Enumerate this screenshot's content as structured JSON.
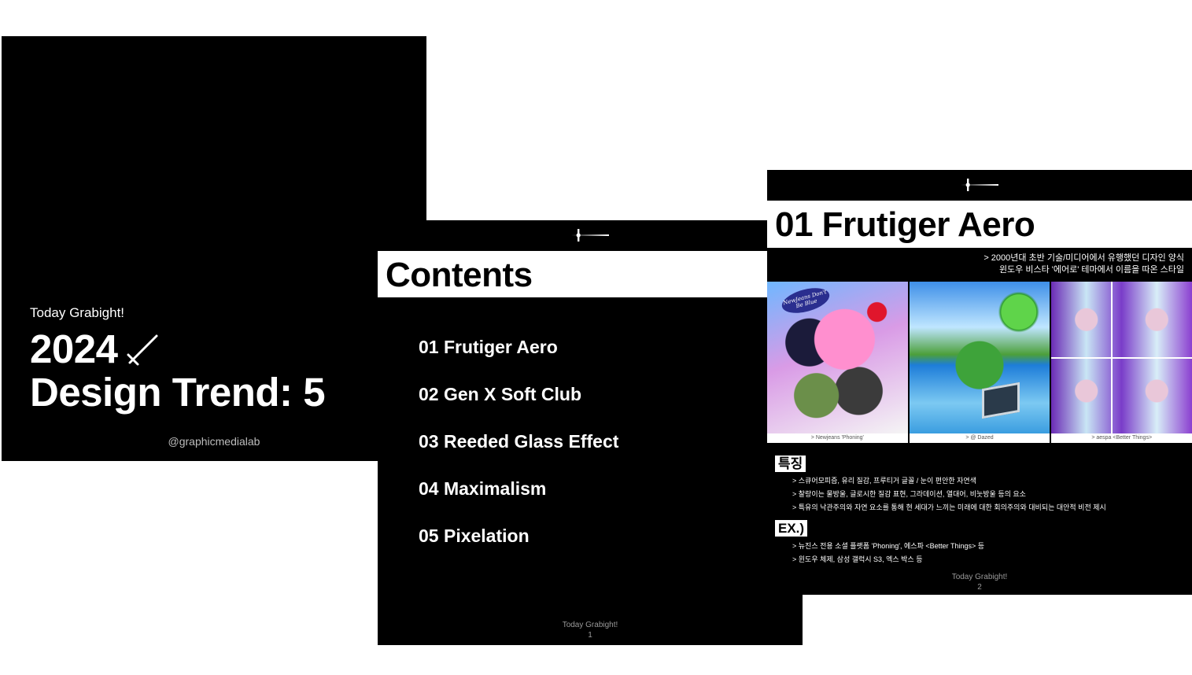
{
  "cover": {
    "subtitle": "Today Grabight!",
    "title_year": "2024",
    "title_line2": "Design Trend: 5",
    "handle": "@graphicmedialab",
    "icon": "sword-icon"
  },
  "contents": {
    "logo": "dagger-logo-icon",
    "title": "Contents",
    "items": [
      {
        "label": "01 Frutiger Aero"
      },
      {
        "label": "02 Gen X Soft Club"
      },
      {
        "label": "03 Reeded Glass Effect"
      },
      {
        "label": "04 Maximalism"
      },
      {
        "label": "05 Pixelation"
      }
    ],
    "footer_text": "Today Grabight!",
    "page_number": "1"
  },
  "aero": {
    "logo": "dagger-logo-icon",
    "title": "01 Frutiger Aero",
    "desc_line1": "> 2000년대 초반 기술/미디어에서 유행했던 디자인 양식",
    "desc_line2": "윈도우 비스타 '에어로' 테마에서 이름을 따온 스타일",
    "images": [
      {
        "caption": "> Newjeans 'Phoning'",
        "badge": "NewJeans Don't Be Blue"
      },
      {
        "caption": "> @ Dazed"
      },
      {
        "caption": "> aespa <Better Things>"
      }
    ],
    "features_title": "특징",
    "features": [
      "> 스큐어모피즘, 유리 질감, 프루티거 글꼴 / 눈이 편안한 자연색",
      "> 찰랑이는 물방울, 글로시한 질감 표현, 그라데이션, 열대어, 비눗방울 등의 요소",
      "> 특유의 낙관주의와 자연 요소를 통해 현 세대가 느끼는 미래에 대한 회의주의와 대비되는 대안적 비전 제시"
    ],
    "examples_title": "EX.)",
    "examples": [
      "> 뉴진스 전용 소셜 플랫폼 'Phoning', 에스파 <Better Things> 등",
      "> 윈도우 체제, 삼성 갤럭시 S3, 엑스 박스 등"
    ],
    "footer_text": "Today Grabight!",
    "page_number": "2"
  }
}
